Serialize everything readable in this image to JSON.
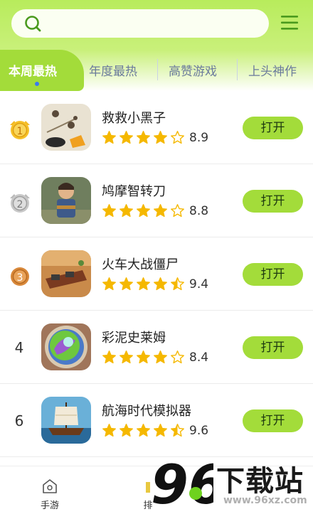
{
  "search": {
    "placeholder": ""
  },
  "tabs": [
    {
      "label": "本周最热",
      "active": true
    },
    {
      "label": "年度最热",
      "active": false
    },
    {
      "label": "高赞游戏",
      "active": false
    },
    {
      "label": "上头神作",
      "active": false
    }
  ],
  "apps": [
    {
      "rank": "1",
      "rank_style": "gold",
      "name": "救救小黑子",
      "stars": 4,
      "rating": "8.9",
      "button": "打开"
    },
    {
      "rank": "2",
      "rank_style": "silver",
      "name": "鸠摩智转刀",
      "stars": 4,
      "rating": "8.8",
      "button": "打开"
    },
    {
      "rank": "3",
      "rank_style": "bronze",
      "name": "火车大战僵尸",
      "stars": 4.5,
      "rating": "9.4",
      "button": "打开"
    },
    {
      "rank": "4",
      "rank_style": "plain",
      "name": "彩泥史莱姆",
      "stars": 4,
      "rating": "8.4",
      "button": "打开"
    },
    {
      "rank": "6",
      "rank_style": "plain",
      "name": "航海时代模拟器",
      "stars": 4.5,
      "rating": "9.6",
      "button": "打开"
    }
  ],
  "bottom_nav": [
    {
      "label": "手游",
      "icon": "home-icon"
    },
    {
      "label": "排",
      "icon": "ranking-icon"
    }
  ],
  "watermark": {
    "digits": "96",
    "text": "下载站",
    "url": "www.96xz.com"
  },
  "colors": {
    "accent": "#a3dc3a",
    "header_top": "#b8ec5c",
    "star": "#f5b800",
    "tab_text": "#6b7a9c"
  }
}
